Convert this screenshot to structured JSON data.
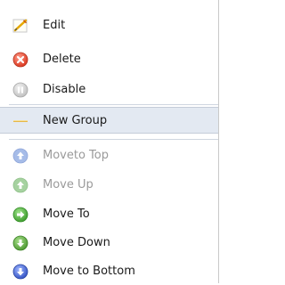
{
  "menu": {
    "items": [
      {
        "label": "Edit",
        "icon": "edit-icon",
        "enabled": true
      },
      {
        "label": "Delete",
        "icon": "delete-icon",
        "enabled": true
      },
      {
        "label": "Disable",
        "icon": "pause-icon",
        "enabled": true
      },
      {
        "label": "New Group",
        "icon": "new-group-icon",
        "enabled": true,
        "highlighted": true
      },
      {
        "label": "Moveto Top",
        "icon": "move-top-icon",
        "enabled": false
      },
      {
        "label": "Move Up",
        "icon": "move-up-icon",
        "enabled": false
      },
      {
        "label": "Move To",
        "icon": "move-to-icon",
        "enabled": true
      },
      {
        "label": "Move Down",
        "icon": "move-down-icon",
        "enabled": true
      },
      {
        "label": "Move to Bottom",
        "icon": "move-bottom-icon",
        "enabled": true
      }
    ]
  },
  "colors": {
    "delete": "#e0523a",
    "disable": "#c8c8c8",
    "move_to": "#4cae3a",
    "move_down": "#5a9e3a",
    "move_bottom": "#3c5ecf",
    "disabled_blue": "#a6bce8",
    "disabled_green": "#a6d2a0",
    "highlight_bg": "#e3e9f2"
  }
}
